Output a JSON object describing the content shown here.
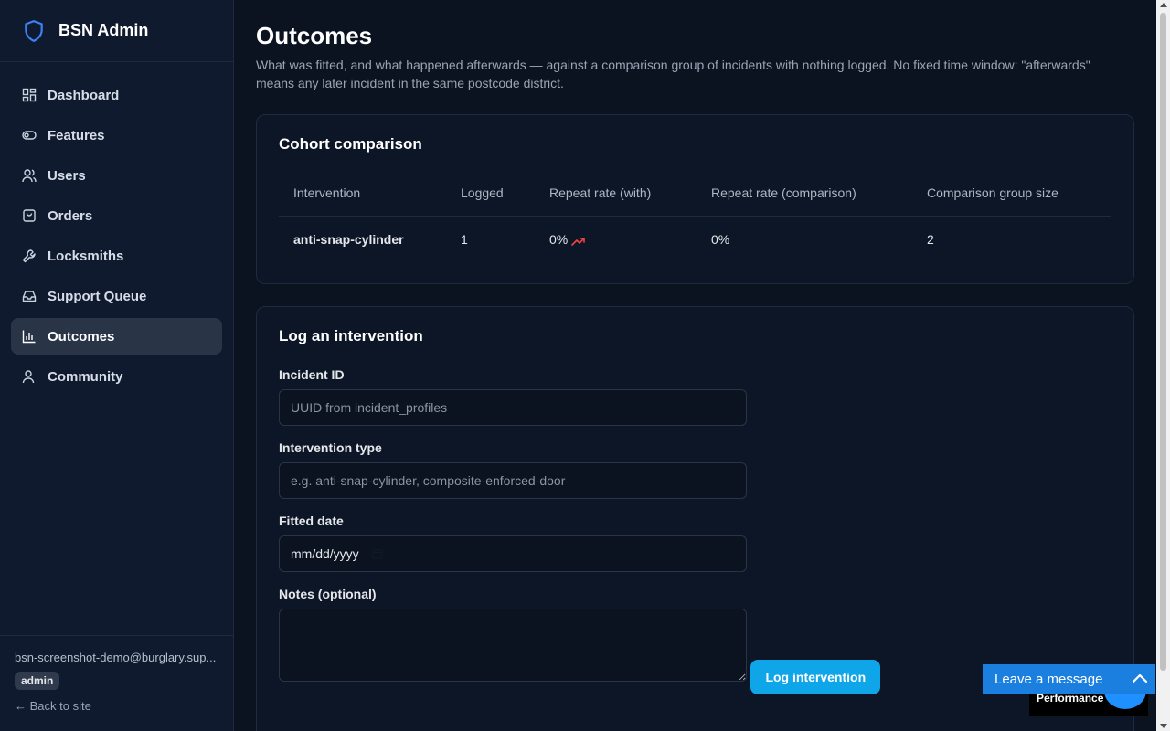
{
  "brand": {
    "title": "BSN Admin",
    "icon": "shield-icon"
  },
  "nav": [
    {
      "label": "Dashboard",
      "icon": "dashboard-icon"
    },
    {
      "label": "Features",
      "icon": "toggle-icon"
    },
    {
      "label": "Users",
      "icon": "users-icon"
    },
    {
      "label": "Orders",
      "icon": "bag-icon"
    },
    {
      "label": "Locksmiths",
      "icon": "wrench-icon"
    },
    {
      "label": "Support Queue",
      "icon": "inbox-icon"
    },
    {
      "label": "Outcomes",
      "icon": "bar-chart-icon",
      "active": true
    },
    {
      "label": "Community",
      "icon": "user-icon"
    }
  ],
  "footer": {
    "email": "bsn-screenshot-demo@burglary.sup...",
    "role": "admin",
    "back_link": "← Back to site"
  },
  "page": {
    "title": "Outcomes",
    "description": "What was fitted, and what happened afterwards — against a comparison group of incidents with nothing logged. No fixed time window: \"afterwards\" means any later incident in the same postcode district."
  },
  "cohort": {
    "title": "Cohort comparison",
    "columns": [
      "Intervention",
      "Logged",
      "Repeat rate (with)",
      "Repeat rate (comparison)",
      "Comparison group size"
    ],
    "rows": [
      {
        "intervention": "anti-snap-cylinder",
        "logged": "1",
        "repeat_with": "0%",
        "repeat_comparison": "0%",
        "group_size": "2",
        "trend_icon": "trending-up-icon",
        "trend_color": "#ef4444"
      }
    ]
  },
  "form": {
    "title": "Log an intervention",
    "incident_label": "Incident ID",
    "incident_placeholder": "UUID from incident_profiles",
    "type_label": "Intervention type",
    "type_placeholder": "e.g. anti-snap-cylinder, composite-enforced-door",
    "date_label": "Fitted date",
    "date_placeholder": "mm/dd/yyyy",
    "notes_label": "Notes (optional)",
    "submit_label": "Log intervention"
  },
  "widgets": {
    "leave_message": "Leave a message",
    "performance": "Performance"
  },
  "colors": {
    "accent": "#0ea5e9",
    "chat": "#1b7fe0",
    "background": "#0b1220"
  }
}
